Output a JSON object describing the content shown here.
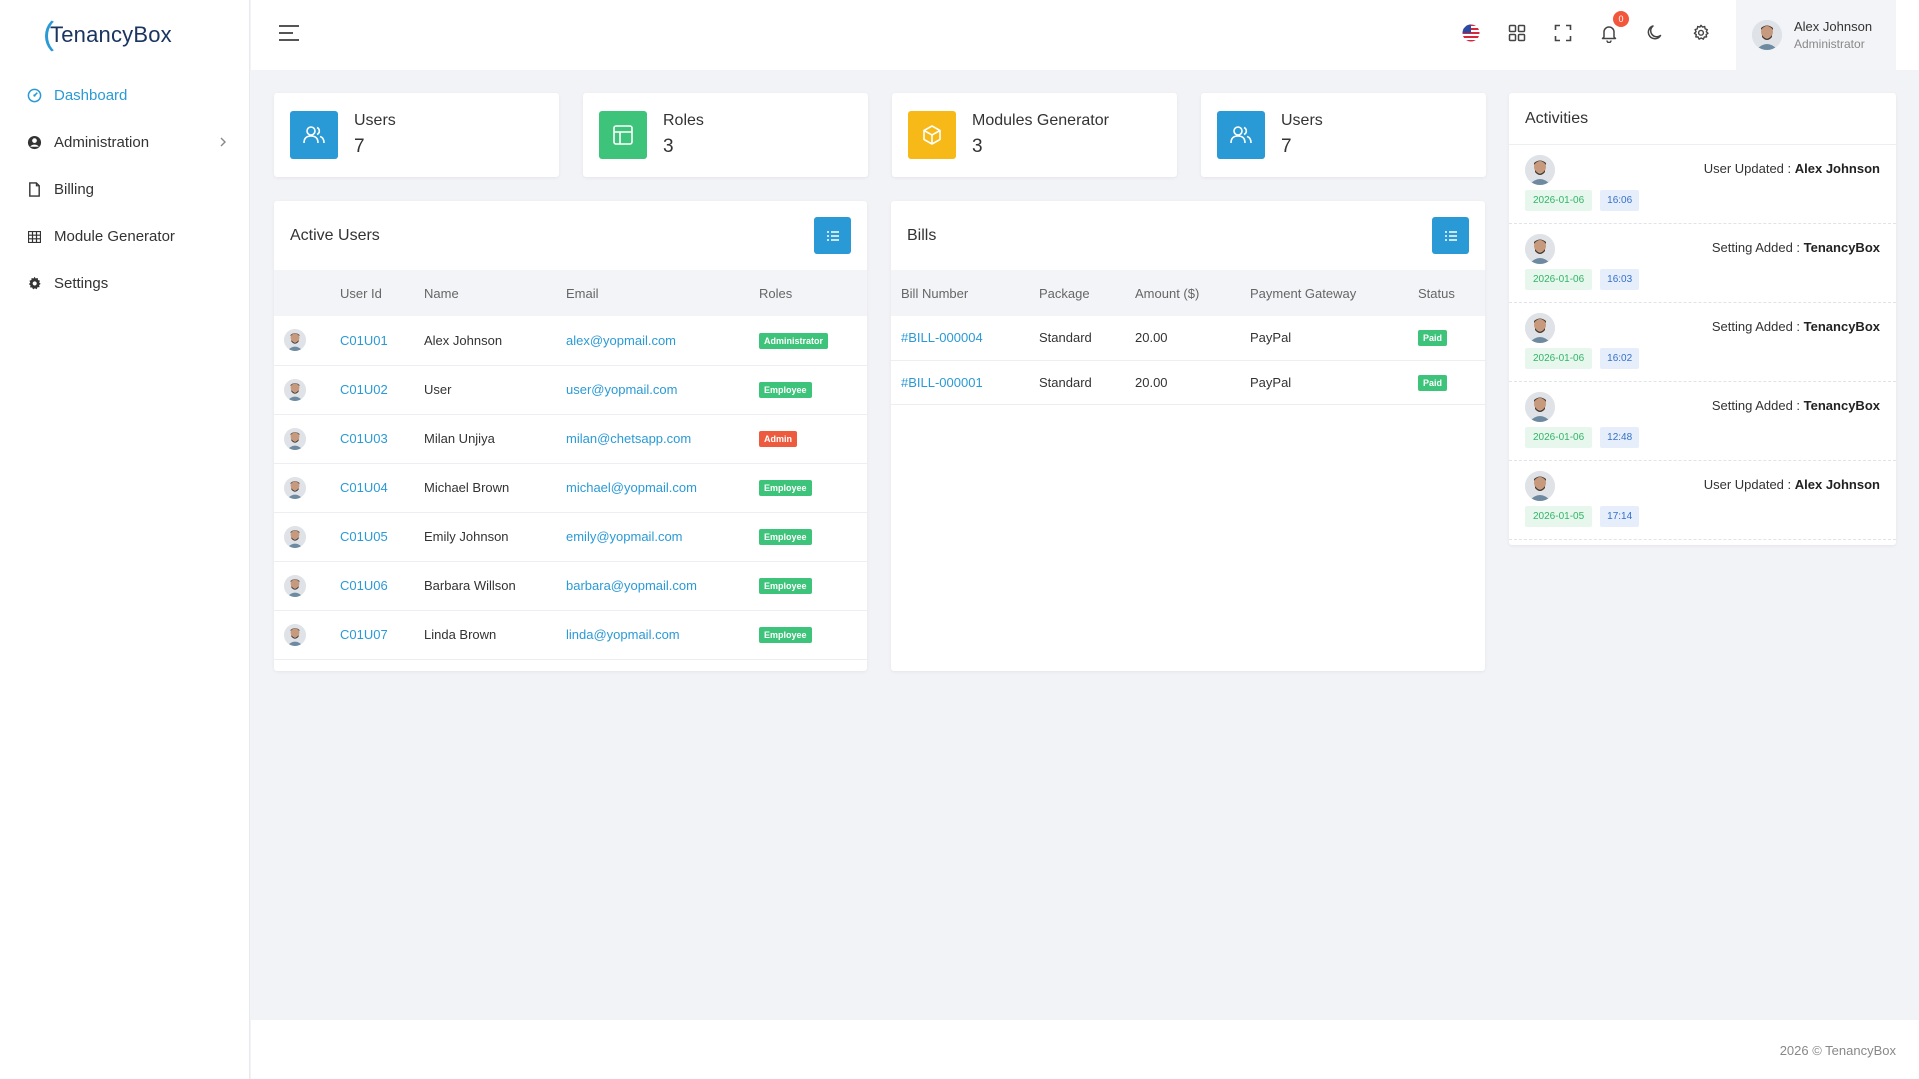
{
  "brand": {
    "name": "TenancyBox"
  },
  "sidebar": {
    "items": [
      {
        "label": "Dashboard",
        "icon": "gauge-icon"
      },
      {
        "label": "Administration",
        "icon": "user-circle-icon"
      },
      {
        "label": "Billing",
        "icon": "file-icon"
      },
      {
        "label": "Module Generator",
        "icon": "grid-icon"
      },
      {
        "label": "Settings",
        "icon": "gear-icon"
      }
    ]
  },
  "topbar": {
    "notification_count": "0",
    "user": {
      "name": "Alex Johnson",
      "role": "Administrator"
    }
  },
  "stats": [
    {
      "label": "Users",
      "value": "7",
      "color": "#2a9ad6",
      "icon": "users-icon"
    },
    {
      "label": "Roles",
      "value": "3",
      "color": "#3ec47a",
      "icon": "layout-icon"
    },
    {
      "label": "Modules Generator",
      "value": "3",
      "color": "#f7b917",
      "icon": "box-icon"
    },
    {
      "label": "Users",
      "value": "7",
      "color": "#2a9ad6",
      "icon": "users-icon"
    }
  ],
  "active_users": {
    "title": "Active Users",
    "columns": [
      "User Id",
      "Name",
      "Email",
      "Roles"
    ],
    "rows": [
      {
        "id": "C01U01",
        "name": "Alex Johnson",
        "email": "alex@yopmail.com",
        "role": "Administrator",
        "role_color": "#3ec47a"
      },
      {
        "id": "C01U02",
        "name": "User",
        "email": "user@yopmail.com",
        "role": "Employee",
        "role_color": "#3ec47a"
      },
      {
        "id": "C01U03",
        "name": "Milan Unjiya",
        "email": "milan@chetsapp.com",
        "role": "Admin",
        "role_color": "#ee5a3e"
      },
      {
        "id": "C01U04",
        "name": "Michael Brown",
        "email": "michael@yopmail.com",
        "role": "Employee",
        "role_color": "#3ec47a"
      },
      {
        "id": "C01U05",
        "name": "Emily Johnson",
        "email": "emily@yopmail.com",
        "role": "Employee",
        "role_color": "#3ec47a"
      },
      {
        "id": "C01U06",
        "name": "Barbara Willson",
        "email": "barbara@yopmail.com",
        "role": "Employee",
        "role_color": "#3ec47a"
      },
      {
        "id": "C01U07",
        "name": "Linda Brown",
        "email": "linda@yopmail.com",
        "role": "Employee",
        "role_color": "#3ec47a"
      }
    ]
  },
  "bills": {
    "title": "Bills",
    "columns": [
      "Bill Number",
      "Package",
      "Amount ($)",
      "Payment Gateway",
      "Status"
    ],
    "rows": [
      {
        "number": "#BILL-000004",
        "package": "Standard",
        "amount": "20.00",
        "gateway": "PayPal",
        "status": "Paid"
      },
      {
        "number": "#BILL-000001",
        "package": "Standard",
        "amount": "20.00",
        "gateway": "PayPal",
        "status": "Paid"
      }
    ]
  },
  "activities": {
    "title": "Activities",
    "items": [
      {
        "action": "User Updated : ",
        "target": "Alex Johnson",
        "date": "2026-01-06",
        "time": "16:06"
      },
      {
        "action": "Setting Added : ",
        "target": "TenancyBox",
        "date": "2026-01-06",
        "time": "16:03"
      },
      {
        "action": "Setting Added : ",
        "target": "TenancyBox",
        "date": "2026-01-06",
        "time": "16:02"
      },
      {
        "action": "Setting Added : ",
        "target": "TenancyBox",
        "date": "2026-01-06",
        "time": "12:48"
      },
      {
        "action": "User Updated : ",
        "target": "Alex Johnson",
        "date": "2026-01-05",
        "time": "17:14"
      }
    ]
  },
  "footer": {
    "text": "2026 © TenancyBox"
  }
}
